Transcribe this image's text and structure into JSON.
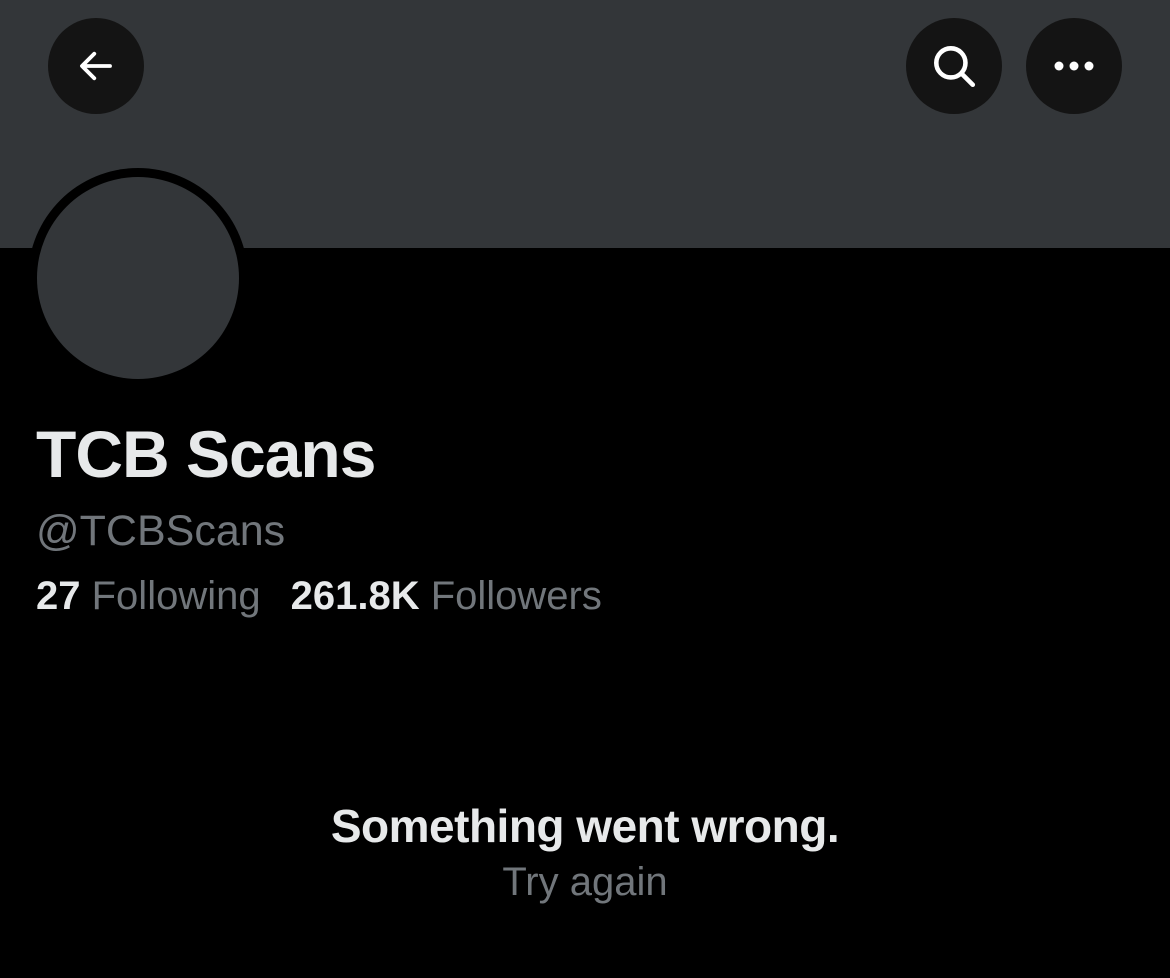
{
  "profile": {
    "display_name": "TCB Scans",
    "handle": "@TCBScans",
    "following_count": "27",
    "following_label": "Following",
    "followers_count": "261.8K",
    "followers_label": "Followers"
  },
  "error": {
    "title": "Something went wrong.",
    "retry_label": "Try again"
  },
  "icons": {
    "back": "arrow-left-icon",
    "search": "search-icon",
    "more": "more-horizontal-icon"
  },
  "colors": {
    "background": "#000000",
    "banner": "#333639",
    "primary_text": "#e7e9ea",
    "secondary_text": "#71767b",
    "button_bg": "#141414"
  }
}
